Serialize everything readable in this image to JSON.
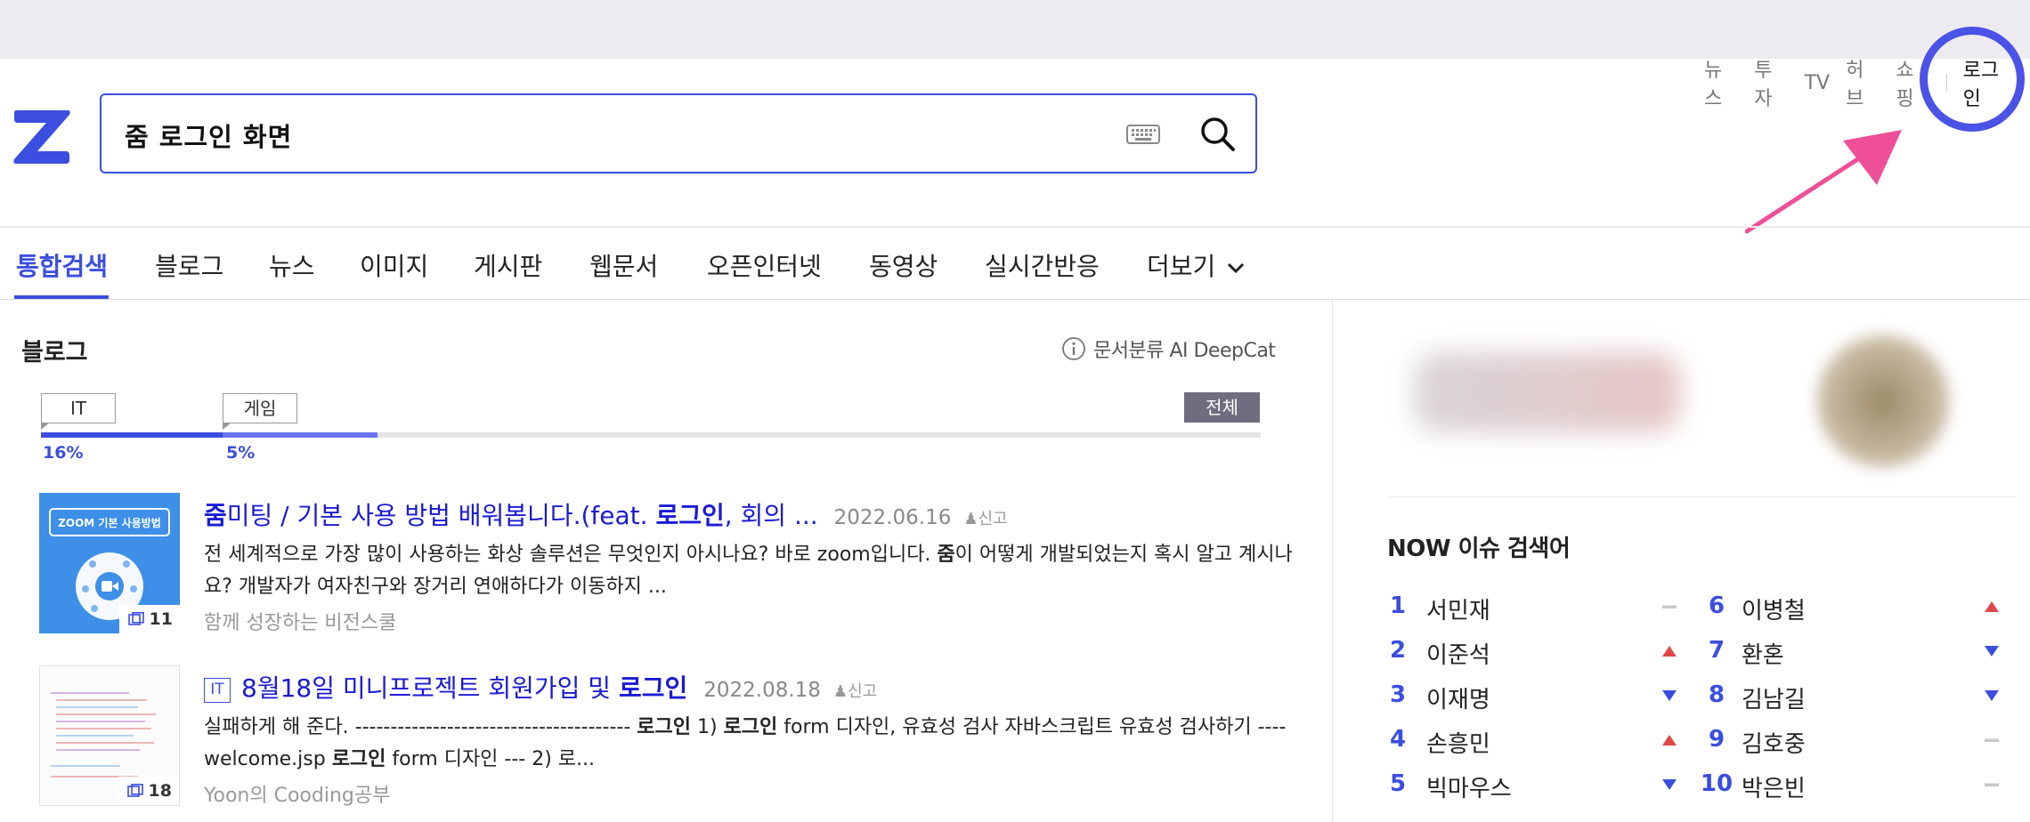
{
  "search": {
    "query": "줌 로그인 화면"
  },
  "topnav": {
    "items": [
      "뉴스",
      "투자",
      "TV",
      "허브",
      "쇼핑"
    ],
    "login": "로그인"
  },
  "tabs": [
    {
      "label": "통합검색",
      "active": true
    },
    {
      "label": "블로그"
    },
    {
      "label": "뉴스"
    },
    {
      "label": "이미지"
    },
    {
      "label": "게시판"
    },
    {
      "label": "웹문서"
    },
    {
      "label": "오픈인터넷"
    },
    {
      "label": "동영상"
    },
    {
      "label": "실시간반응"
    },
    {
      "label": "더보기"
    }
  ],
  "blog": {
    "title": "블로그",
    "deepcat": "문서분류 AI DeepCat",
    "categories": [
      {
        "label": "IT",
        "percent": "16%"
      },
      {
        "label": "게임",
        "percent": "5%"
      }
    ],
    "all_label": "전체",
    "results": [
      {
        "title_pre": "줌",
        "title_mid1": "미팅 / 기본 사용 방법 배워봅니다.(feat. ",
        "title_bold": "로그인",
        "title_post": ", 회의 ...",
        "date": "2022.06.16",
        "report": "신고",
        "desc_pre": "전 세계적으로 가장 많이 사용하는 화상 솔루션은 무엇인지 아시나요? 바로 zoom입니다. ",
        "desc_bold": "줌",
        "desc_post": "이 어떻게 개발되었는지 혹시 알고 계시나요? 개발자가 여자친구와 장거리 연애하다가 이동하지 ...",
        "source": "함께 성장하는 비전스쿨",
        "image_count": "11",
        "thumb_text": "ZOOM 기본 사용방법"
      },
      {
        "badge": "IT",
        "title_pre": "8월18일 미니프로젝트 회원가입 및 ",
        "title_bold": "로그인",
        "date": "2022.08.18",
        "report": "신고",
        "desc_pre": "실패하게 해 준다. --------------------------------------- ",
        "desc_b1": "로그인",
        "desc_mid1": " 1) ",
        "desc_b2": "로그인",
        "desc_mid2": " form 디자인, 유효성 검사 자바스크립트 유효성 검사하기 ---- welcome.jsp ",
        "desc_b3": "로그인",
        "desc_post": " form 디자인 --- 2) 로...",
        "source": "Yoon의 Cooding공부",
        "image_count": "18"
      }
    ]
  },
  "now_issue": {
    "title": "NOW 이슈 검색어",
    "items": [
      {
        "rank": "1",
        "name": "서민재",
        "trend": "same"
      },
      {
        "rank": "2",
        "name": "이준석",
        "trend": "up"
      },
      {
        "rank": "3",
        "name": "이재명",
        "trend": "down"
      },
      {
        "rank": "4",
        "name": "손흥민",
        "trend": "up"
      },
      {
        "rank": "5",
        "name": "빅마우스",
        "trend": "down"
      },
      {
        "rank": "6",
        "name": "이병철",
        "trend": "up"
      },
      {
        "rank": "7",
        "name": "환혼",
        "trend": "down"
      },
      {
        "rank": "8",
        "name": "김남길",
        "trend": "down"
      },
      {
        "rank": "9",
        "name": "김호중",
        "trend": "same"
      },
      {
        "rank": "10",
        "name": "박은빈",
        "trend": "same"
      }
    ]
  },
  "colors": {
    "accent": "#3b4ee0",
    "highlight_circle": "#4b52e6",
    "arrow": "#ee4f97",
    "trend_up": "#e04848",
    "trend_down": "#3b4ee0",
    "trend_same": "#c8c8c8"
  }
}
